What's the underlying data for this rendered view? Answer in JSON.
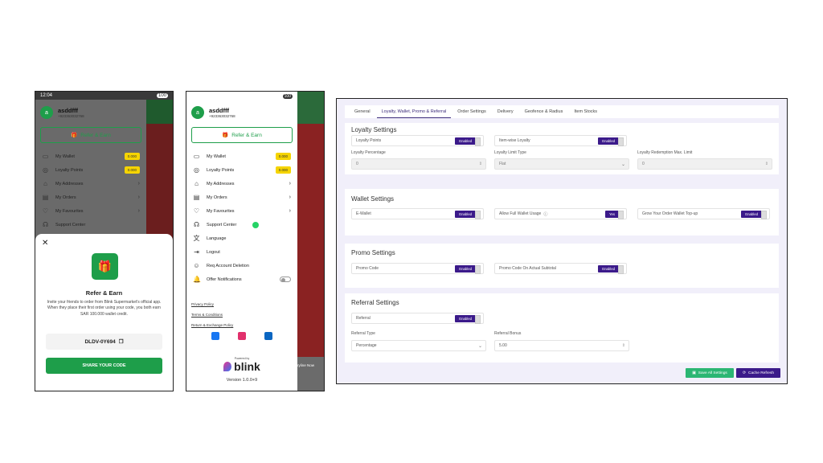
{
  "phone1": {
    "status_time": "12:04",
    "status_battery": "100",
    "user_name": "asddfff",
    "user_phone": "+923363032768",
    "avatar_letter": "a",
    "refer_label": "Refer & Earn",
    "menu": [
      {
        "label": "My Wallet",
        "badge": "0.000"
      },
      {
        "label": "Loyalty Points",
        "badge": "0.000"
      },
      {
        "label": "My Addresses"
      },
      {
        "label": "My Orders"
      },
      {
        "label": "My Favourites"
      },
      {
        "label": "Support Center"
      }
    ],
    "sheet": {
      "title": "Refer & Earn",
      "desc": "Invite your friends to order from Blink Supermarket's official app. When they place their first order using your code, you both earn SAR 100.000 wallet credit.",
      "code": "DLDV-0Y694",
      "share": "SHARE YOUR CODE"
    }
  },
  "phone2": {
    "status_battery": "100",
    "user_name": "asddfff",
    "user_phone": "+923363032768",
    "avatar_letter": "a",
    "refer_label": "Refer & Earn",
    "menu": [
      {
        "label": "My Wallet",
        "badge": "0.000"
      },
      {
        "label": "Loyalty Points",
        "badge": "0.000"
      },
      {
        "label": "My Addresses"
      },
      {
        "label": "My Orders"
      },
      {
        "label": "My Favourites"
      },
      {
        "label": "Support Center"
      },
      {
        "label": "Language"
      },
      {
        "label": "Logout"
      },
      {
        "label": "Req Account Deletion"
      },
      {
        "label": "Offer Notifications"
      }
    ],
    "links": [
      "Privacy Policy",
      "Terms & Conditions",
      "Return & Exchange Policy"
    ],
    "powered_by": "Powered by",
    "brand": "blink",
    "version": "Version 1.0.0+9",
    "side_text": "ryline Now"
  },
  "admin": {
    "tabs": [
      "General",
      "Loyalty, Wallet, Promo & Referral",
      "Order Settings",
      "Delivery",
      "Geofence & Radius",
      "Item Stocks"
    ],
    "loyalty": {
      "title": "Loyalty Settings",
      "loyalty_points": "Loyalty Points",
      "item_wise": "Item-wise Loyalty",
      "enabled": "Enabled",
      "pct_label": "Loyalty Percentage",
      "pct_value": "0",
      "limit_label": "Loyalty Limit Type",
      "limit_value": "Flat",
      "max_label": "Loyalty Redemption Max. Limit",
      "max_value": "0"
    },
    "wallet": {
      "title": "Wallet Settings",
      "ewallet": "E-Wallet",
      "full_usage": "Allow Full Wallet Usage",
      "yes": "Yes",
      "topup": "Grow Your Order Wallet Top-up",
      "enabled": "Enabled"
    },
    "promo": {
      "title": "Promo Settings",
      "code": "Promo Code",
      "actual": "Promo Code On Actual Subtotal",
      "enabled": "Enabled"
    },
    "referral": {
      "title": "Referral Settings",
      "referral": "Referral",
      "enabled": "Enabled",
      "type_label": "Referral Type",
      "type_value": "Percentage",
      "bonus_label": "Referral Bonus",
      "bonus_value": "5.00"
    },
    "save_all": "Save All Settings",
    "cache_refresh": "Cache Refresh"
  }
}
